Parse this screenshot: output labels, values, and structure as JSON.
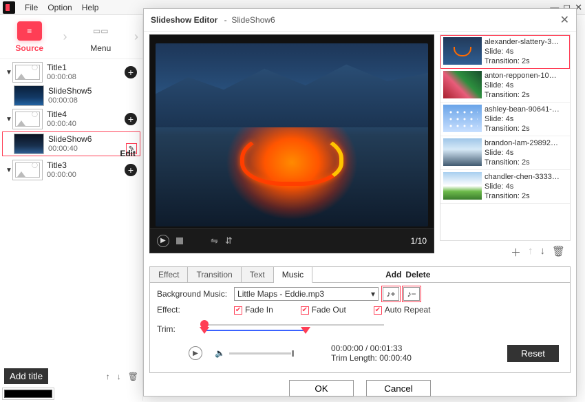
{
  "menubar": {
    "file": "File",
    "option": "Option",
    "help": "Help"
  },
  "sidebar": {
    "tabs": {
      "source": "Source",
      "menu": "Menu"
    },
    "source_icon": "≡",
    "menu_icon": "▭▭",
    "items": [
      {
        "kind": "title",
        "name": "Title1",
        "time": "00:00:08"
      },
      {
        "kind": "slide",
        "name": "SlideShow5",
        "time": "00:00:08"
      },
      {
        "kind": "title",
        "name": "Title4",
        "time": "00:00:40"
      },
      {
        "kind": "slide",
        "name": "SlideShow6",
        "time": "00:00:40",
        "selected": true
      },
      {
        "kind": "title",
        "name": "Title3",
        "time": "00:00:00"
      }
    ],
    "edit_label": "Edit",
    "add_title": "Add title"
  },
  "dialog": {
    "title": "Slideshow Editor",
    "subtitle": "SlideShow6",
    "counter": "1/10",
    "slides": [
      {
        "name": "alexander-slattery-3…",
        "slide": "Slide: 4s",
        "trans": "Transition: 2s",
        "selected": true,
        "cls": "s1"
      },
      {
        "name": "anton-repponen-10…",
        "slide": "Slide: 4s",
        "trans": "Transition: 2s",
        "cls": "s2"
      },
      {
        "name": "ashley-bean-90641-…",
        "slide": "Slide: 4s",
        "trans": "Transition: 2s",
        "cls": "s3"
      },
      {
        "name": "brandon-lam-29892…",
        "slide": "Slide: 4s",
        "trans": "Transition: 2s",
        "cls": "s4"
      },
      {
        "name": "chandler-chen-3333…",
        "slide": "Slide: 4s",
        "trans": "Transition: 2s",
        "cls": "s5"
      }
    ],
    "tabs": {
      "effect": "Effect",
      "transition": "Transition",
      "text": "Text",
      "music": "Music"
    },
    "annot": {
      "add": "Add",
      "delete": "Delete"
    },
    "music": {
      "bg_label": "Background Music:",
      "bg_value": "Little Maps - Eddie.mp3",
      "effect_label": "Effect:",
      "fade_in": "Fade In",
      "fade_out": "Fade Out",
      "auto_repeat": "Auto Repeat",
      "trim_label": "Trim:",
      "time": "00:00:00 / 00:01:33",
      "trim_len": "Trim Length: 00:00:40",
      "reset": "Reset"
    },
    "footer": {
      "ok": "OK",
      "cancel": "Cancel"
    }
  }
}
